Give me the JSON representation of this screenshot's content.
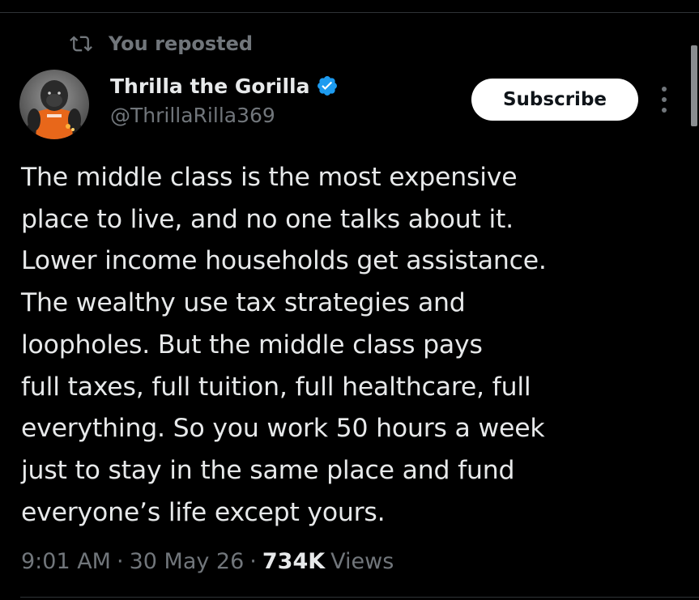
{
  "repost": {
    "icon": "repost-icon",
    "text": "You reposted"
  },
  "author": {
    "avatar": "gorilla-avatar",
    "display_name": "Thrilla the Gorilla",
    "verified_icon": "verified-badge-icon",
    "handle": "@ThrillaRilla369"
  },
  "actions": {
    "subscribe_label": "Subscribe",
    "more_icon": "more-vertical-icon"
  },
  "post": {
    "text": "The middle class is the most expensive\nplace to live, and no one talks about it.\nLower income households get assistance.\nThe wealthy use tax strategies and\nloopholes. But the middle class pays\nfull taxes, full tuition, full healthcare, full\neverything. So you work 50 hours a week\njust to stay in the same place and fund\neveryone’s life except yours."
  },
  "meta": {
    "time": "9:01 AM",
    "date": "30 May 26",
    "views_count": "734K",
    "views_label": "Views",
    "separator": "·"
  },
  "colors": {
    "background": "#000000",
    "text_primary": "#e7e9ea",
    "text_secondary": "#71767b",
    "verified_blue": "#1d9bf0",
    "button_bg": "#ffffff",
    "button_text": "#0f1419",
    "divider": "#2f3336"
  }
}
